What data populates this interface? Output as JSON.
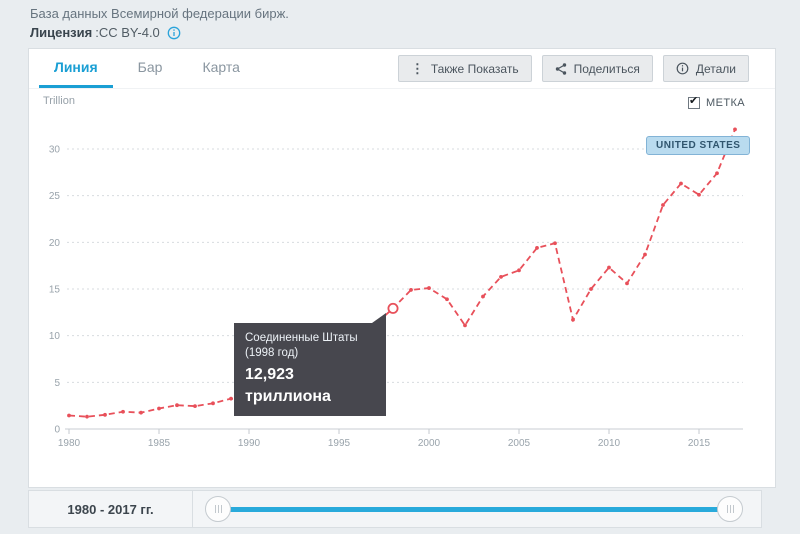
{
  "header": {
    "source": "База данных Всемирной федерации бирж.",
    "license_label": "Лицензия",
    "license_value": ":CC BY-4.0"
  },
  "tabs": [
    {
      "label": "Линия",
      "active": true
    },
    {
      "label": "Бар",
      "active": false
    },
    {
      "label": "Карта",
      "active": false
    }
  ],
  "toolbar": {
    "also_show_label": "Также Показать",
    "share_label": "Поделиться",
    "details_label": "Детали",
    "more_icon_glyph": "⋮"
  },
  "chart": {
    "unit_label": "Trillion",
    "metka_label": "МЕТКА",
    "metka_checked": true,
    "series_label": "UNITED STATES",
    "line_color": "#e8505a",
    "tooltip": {
      "title": "Соединенные Штаты",
      "subtitle": "(1998 год)",
      "value": "12,923",
      "unit": "триллиона"
    }
  },
  "chart_data": {
    "type": "line",
    "title": "",
    "xlabel": "",
    "ylabel": "Trillion",
    "ylim": [
      0,
      33
    ],
    "yticks": [
      0,
      5,
      10,
      15,
      20,
      25,
      30
    ],
    "xticks": [
      1980,
      1985,
      1990,
      1995,
      2000,
      2005,
      2010,
      2015
    ],
    "grid": "horizontal-dotted",
    "legend_position": "top-right-flag",
    "x": [
      1980,
      1981,
      1982,
      1983,
      1984,
      1985,
      1986,
      1987,
      1988,
      1989,
      1990,
      1991,
      1992,
      1993,
      1994,
      1995,
      1996,
      1997,
      1998,
      1999,
      2000,
      2001,
      2002,
      2003,
      2004,
      2005,
      2006,
      2007,
      2008,
      2009,
      2010,
      2011,
      2012,
      2013,
      2014,
      2015,
      2016,
      2017
    ],
    "series": [
      {
        "name": "UNITED STATES",
        "values": [
          1.45,
          1.32,
          1.52,
          1.85,
          1.75,
          2.2,
          2.55,
          2.45,
          2.75,
          3.25,
          3.05,
          4.05,
          4.45,
          5.0,
          5.05,
          6.8,
          8.4,
          11.2,
          12.923,
          14.9,
          15.1,
          13.9,
          11.1,
          14.2,
          16.3,
          17.0,
          19.4,
          19.9,
          11.7,
          15.0,
          17.3,
          15.6,
          18.7,
          24.0,
          26.3,
          25.1,
          27.4,
          32.1
        ]
      }
    ],
    "highlight": {
      "year": 1998,
      "value": 12.923
    }
  },
  "footer": {
    "range_label": "1980 - 2017 гг.",
    "slider": {
      "min": 1980,
      "max": 2017,
      "from": 1980,
      "to": 2017
    }
  },
  "colors": {
    "accent_cyan": "#29aadb",
    "tab_active": "#1a9fd4",
    "line_red": "#e8505a",
    "tooltip_bg": "#47474e",
    "flag_bg": "#b9dbef",
    "axis_text": "#99a3ab",
    "info_icon_blue": "#2aa3da"
  }
}
